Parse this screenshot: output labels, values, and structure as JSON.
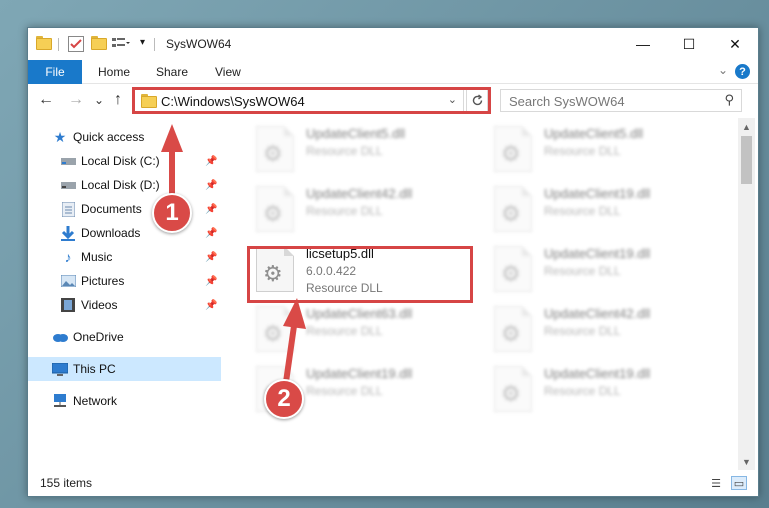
{
  "window": {
    "title": "SysWOW64",
    "minimize_glyph": "—",
    "maximize_glyph": "☐",
    "close_glyph": "✕"
  },
  "ribbon": {
    "file": "File",
    "home": "Home",
    "share": "Share",
    "view": "View",
    "help": "?"
  },
  "nav": {
    "back": "←",
    "forward": "→",
    "recent": "⌄",
    "up": "↑",
    "address": "C:\\Windows\\SysWOW64",
    "search_placeholder": "Search SysWOW64"
  },
  "sidebar": {
    "items": [
      {
        "label": "Quick access",
        "icon": "star-icon"
      },
      {
        "label": "Local Disk (C:)",
        "icon": "drive-icon"
      },
      {
        "label": "Local Disk (D:)",
        "icon": "drive-icon"
      },
      {
        "label": "Documents",
        "icon": "documents-icon"
      },
      {
        "label": "Downloads",
        "icon": "downloads-icon"
      },
      {
        "label": "Music",
        "icon": "music-icon"
      },
      {
        "label": "Pictures",
        "icon": "pictures-icon"
      },
      {
        "label": "Videos",
        "icon": "videos-icon"
      },
      {
        "label": "OneDrive",
        "icon": "cloud-icon"
      },
      {
        "label": "This PC",
        "icon": "computer-icon"
      },
      {
        "label": "Network",
        "icon": "network-icon"
      }
    ]
  },
  "files": [
    {
      "name": "UpdateClient5.dll",
      "type": "Resource DLL"
    },
    {
      "name": "UpdateClient5.dll",
      "type": "Resource DLL"
    },
    {
      "name": "UpdateClient42.dll",
      "type": "Resource DLL"
    },
    {
      "name": "UpdateClient19.dll",
      "type": "Resource DLL"
    },
    {
      "name": "licsetup5.dll",
      "version": "6.0.0.422",
      "type": "Resource DLL"
    },
    {
      "name": "UpdateClient19.dll",
      "type": "Resource DLL"
    },
    {
      "name": "UpdateClient63.dll",
      "type": "Resource DLL"
    },
    {
      "name": "UpdateClient42.dll",
      "type": "Resource DLL"
    },
    {
      "name": "UpdateClient19.dll",
      "type": "Resource DLL"
    },
    {
      "name": "UpdateClient19.dll",
      "type": "Resource DLL"
    }
  ],
  "status": {
    "count": "155 items"
  },
  "annotations": {
    "step1": "1",
    "step2": "2",
    "highlight_color": "#d64545"
  },
  "colors": {
    "accent": "#1979ca",
    "selected_bg": "#cce8ff"
  }
}
